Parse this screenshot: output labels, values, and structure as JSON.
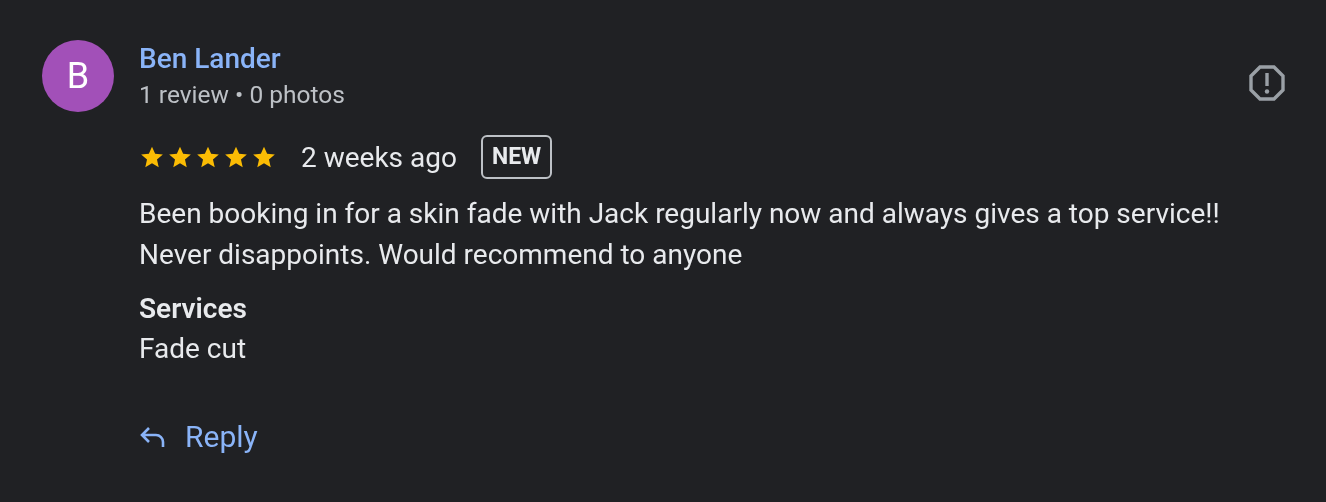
{
  "review": {
    "avatar_letter": "B",
    "reviewer_name": "Ben Lander",
    "reviewer_stats": "1 review • 0 photos",
    "stars": 5,
    "time": "2 weeks ago",
    "badge": "NEW",
    "text": "Been booking in for a skin fade with Jack regularly now and always gives a top service!! Never disappoints. Would recommend to anyone",
    "services_label": "Services",
    "services_value": "Fade cut",
    "reply_button": "Reply"
  }
}
